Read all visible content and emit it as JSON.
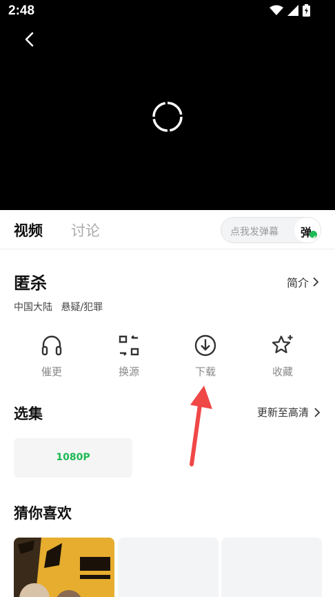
{
  "status_bar": {
    "time": "2:48"
  },
  "player": {
    "state": "loading"
  },
  "tabs": {
    "active": "视频",
    "inactive": "讨论"
  },
  "danmu": {
    "placeholder": "点我发弹幕",
    "button": "弹"
  },
  "show": {
    "title": "匿杀",
    "intro_label": "简介",
    "meta": [
      "中国大陆",
      "悬疑/犯罪"
    ]
  },
  "actions": [
    {
      "label": "催更",
      "icon": "headphones-icon"
    },
    {
      "label": "换源",
      "icon": "switch-source-icon"
    },
    {
      "label": "下载",
      "icon": "download-icon"
    },
    {
      "label": "收藏",
      "icon": "star-icon"
    }
  ],
  "episodes": {
    "title": "选集",
    "more": "更新至高清",
    "items": [
      "1080P"
    ]
  },
  "recommendations": {
    "title": "猜你喜欢"
  },
  "colors": {
    "accent": "#1db954",
    "annotation_arrow": "#f04747"
  }
}
